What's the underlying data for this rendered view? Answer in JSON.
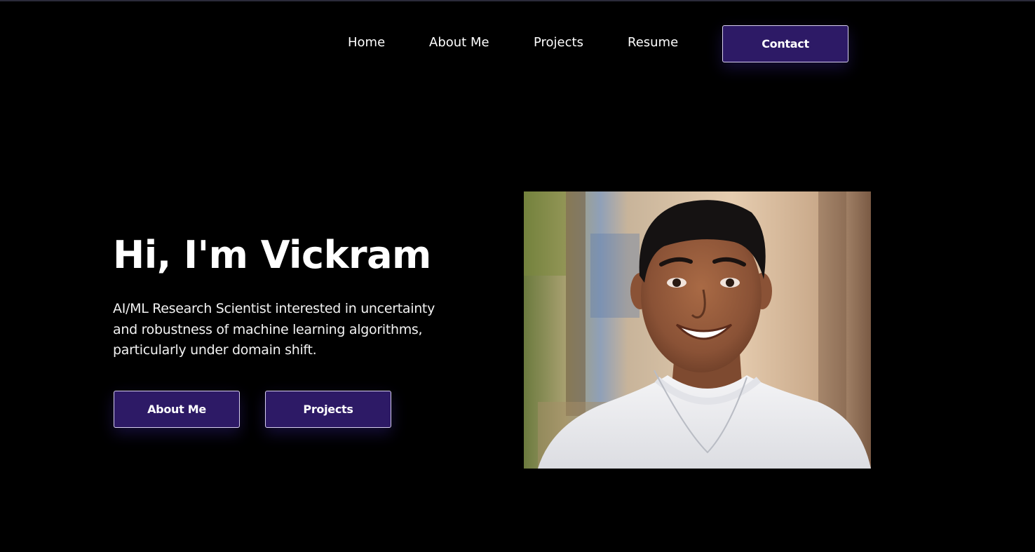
{
  "nav": {
    "links": [
      {
        "label": "Home"
      },
      {
        "label": "About Me"
      },
      {
        "label": "Projects"
      },
      {
        "label": "Resume"
      }
    ],
    "contact_label": "Contact"
  },
  "hero": {
    "title": "Hi, I'm Vickram",
    "description": "AI/ML Research Scientist interested in uncertainty and robustness of machine learning algorithms, particularly under domain shift.",
    "about_button": "About Me",
    "projects_button": "Projects"
  },
  "colors": {
    "background": "#000000",
    "button": "#2d1a66",
    "button_border": "#d8d0f0",
    "text": "#ffffff"
  }
}
